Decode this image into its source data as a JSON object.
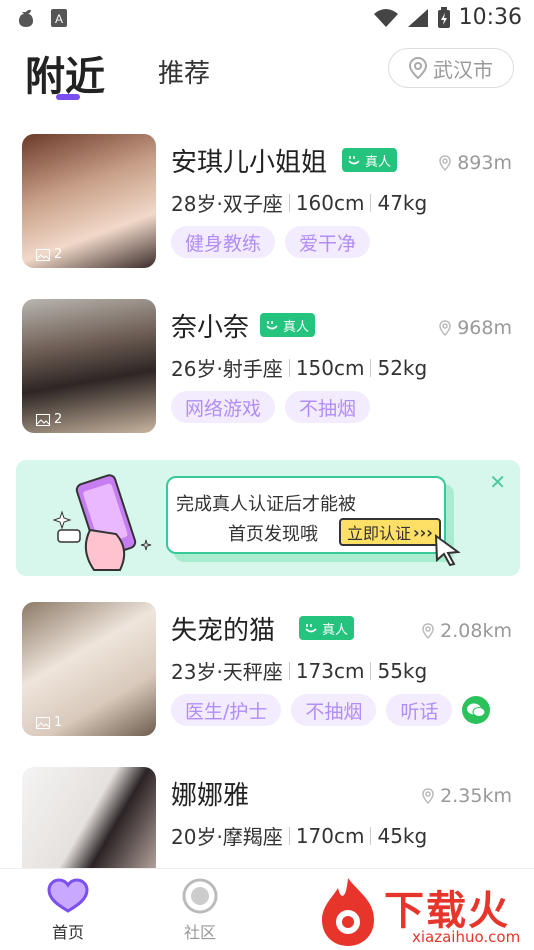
{
  "status_bar": {
    "time": "10:36"
  },
  "header": {
    "tabs": [
      {
        "label": "附近",
        "active": true
      },
      {
        "label": "推荐",
        "active": false
      }
    ],
    "city": "武汉市"
  },
  "users": [
    {
      "name": "安琪儿小姐姐",
      "badge": "真人",
      "distance": "893m",
      "age_sign": "28岁·双子座",
      "height": "160cm",
      "weight": "47kg",
      "tags": [
        "健身教练",
        "爱干净"
      ],
      "photo_count": "2",
      "wechat": false
    },
    {
      "name": "奈小奈",
      "badge": "真人",
      "distance": "968m",
      "age_sign": "26岁·射手座",
      "height": "150cm",
      "weight": "52kg",
      "tags": [
        "网络游戏",
        "不抽烟"
      ],
      "photo_count": "2",
      "wechat": false
    },
    {
      "name": "失宠的猫",
      "badge": "真人",
      "distance": "2.08km",
      "age_sign": "23岁·天秤座",
      "height": "173cm",
      "weight": "55kg",
      "tags": [
        "医生/护士",
        "不抽烟",
        "听话"
      ],
      "photo_count": "1",
      "wechat": true
    },
    {
      "name": "娜娜雅",
      "badge": "",
      "distance": "2.35km",
      "age_sign": "20岁·摩羯座",
      "height": "170cm",
      "weight": "45kg",
      "tags": [],
      "photo_count": "",
      "wechat": false
    }
  ],
  "banner": {
    "line1": "完成真人认证后才能被",
    "line2": "首页发现哦",
    "button": "立即认证"
  },
  "bottom_nav": [
    {
      "label": "首页",
      "icon": "heart-chat-icon",
      "active": true
    },
    {
      "label": "社区",
      "icon": "community-icon",
      "active": false
    }
  ],
  "watermark": {
    "text": "下载火",
    "url": "xiazaihuo.com"
  },
  "colors": {
    "accent": "#7b4ff0",
    "tag_bg": "#f3ecfe",
    "tag_text": "#b18ef5",
    "badge": "#25c47e",
    "banner_bg": "#d7f7ec"
  }
}
